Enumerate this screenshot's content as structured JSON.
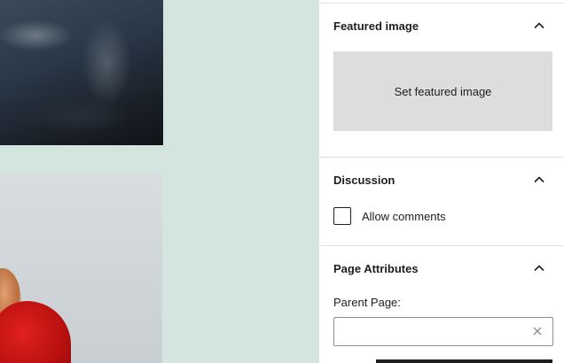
{
  "sidebar": {
    "featured_image": {
      "title": "Featured image",
      "button_label": "Set featured image",
      "icon": "chevron-up-icon"
    },
    "discussion": {
      "title": "Discussion",
      "allow_comments_label": "Allow comments",
      "allow_comments_checked": false,
      "icon": "chevron-up-icon"
    },
    "page_attributes": {
      "title": "Page Attributes",
      "parent_page_label": "Parent Page:",
      "parent_page_value": "",
      "clear_icon": "close-icon",
      "icon": "chevron-up-icon"
    }
  },
  "colors": {
    "canvas_background": "#d4e5df",
    "text": "#1e1e1e",
    "placeholder_button": "#dddddd",
    "border": "#e0e0e0"
  }
}
